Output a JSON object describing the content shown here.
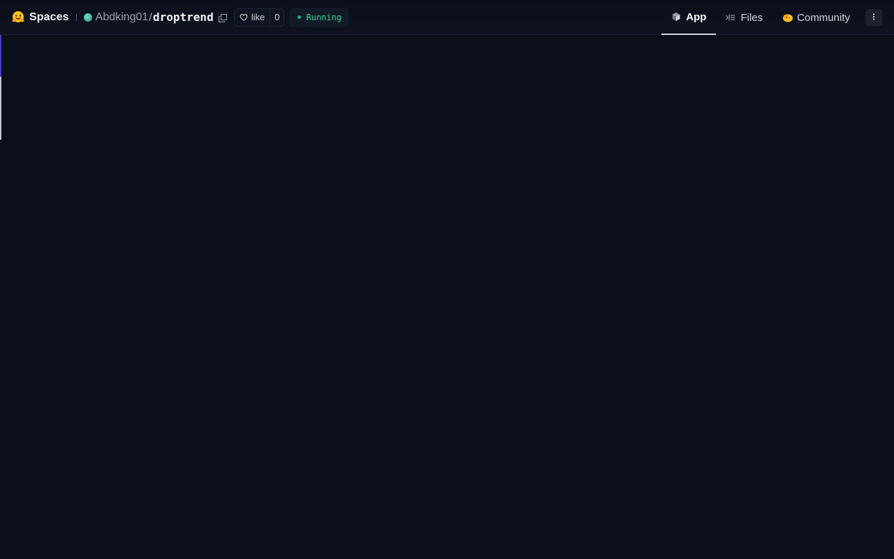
{
  "header": {
    "brand": "Spaces",
    "owner": "Abdking01",
    "separator": "/",
    "repo": "droptrend",
    "like_label": "like",
    "like_count": "0",
    "status": "Running"
  },
  "nav": {
    "tabs": [
      {
        "label": "App",
        "icon": "cube-icon",
        "active": true
      },
      {
        "label": "Files",
        "icon": "files-icon",
        "active": false
      },
      {
        "label": "Community",
        "icon": "community-icon",
        "active": false
      }
    ],
    "menu_icon": "more-vertical-icon"
  },
  "colors": {
    "background": "#0b0f19",
    "status_green": "#34d399",
    "accent": "#4f46e5"
  }
}
